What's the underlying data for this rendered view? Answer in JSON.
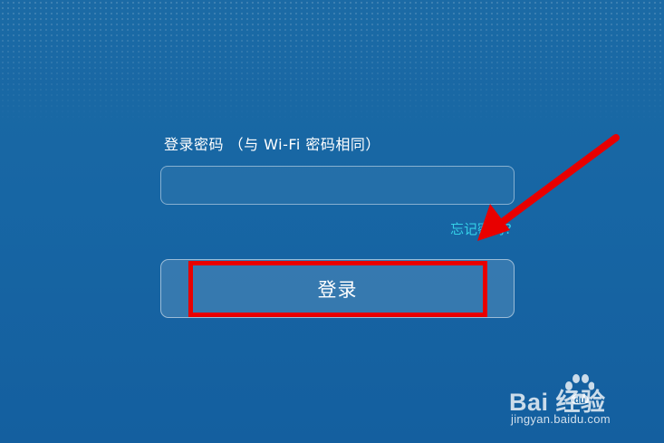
{
  "form": {
    "password_label": "登录密码 （与 Wi-Fi 密码相同）",
    "password_value": "",
    "forgot_link": "忘记密码?",
    "login_button": "登录"
  },
  "annotation": {
    "color": "#e80000"
  },
  "watermark": {
    "logo_text": "Bai  经验",
    "url": "jingyan.baidu.com"
  }
}
